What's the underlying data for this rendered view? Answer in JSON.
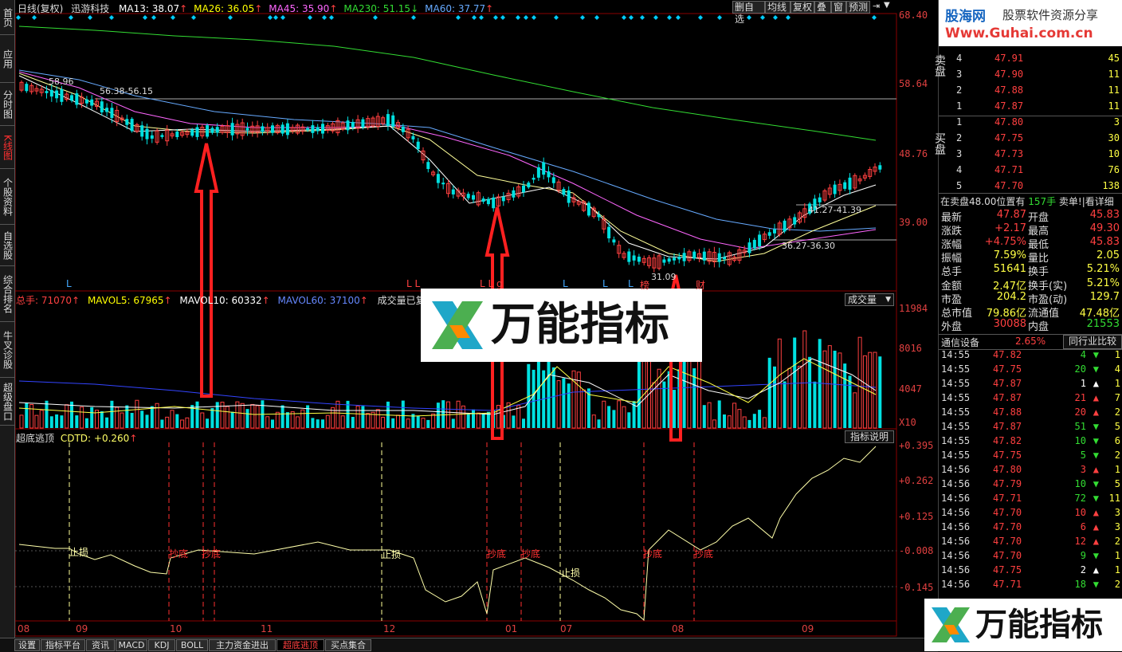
{
  "nav": [
    "首页",
    "应用",
    "分时图",
    "K线图",
    "个股资料",
    "自选股",
    "综合排名",
    "牛叉诊股",
    "超级盘口"
  ],
  "header": {
    "period": "日线(复权)",
    "stock": "迅游科技",
    "mas": [
      {
        "text": "MA13: 38.07",
        "arrow": "↑",
        "color": "#ffffff"
      },
      {
        "text": "MA26: 36.05",
        "arrow": "↑",
        "color": "#ffff00"
      },
      {
        "text": "MA45: 35.90",
        "arrow": "↑",
        "color": "#ff66ff"
      },
      {
        "text": "MA230: 51.15",
        "arrow": "↓",
        "color": "#33dd33"
      },
      {
        "text": "MA60: 37.77",
        "arrow": "↑",
        "color": "#66aaff"
      }
    ]
  },
  "toolbar": [
    "删自选",
    "均线",
    "复权",
    "叠",
    "窗",
    "预测"
  ],
  "price_axis": [
    "68.40",
    "58.64",
    "48.76",
    "39.00"
  ],
  "price_annotations": [
    "58.96",
    "56.38-56.15",
    "41.27-41.39",
    "36.27-36.30",
    "31.09"
  ],
  "markers": [
    "L",
    "L L",
    "L L g",
    "L",
    "L",
    "L",
    "榜",
    "财"
  ],
  "volume": {
    "title": "总手: 71070",
    "ma5": "MAVOL5: 67965",
    "ma10": "MAVOL10: 60332",
    "ma60": "MAVOL60: 37100",
    "note": "成交量已复权",
    "dropdown": "成交量",
    "axis": [
      "11984",
      "8016",
      "4047",
      "X10"
    ]
  },
  "indicator": {
    "title": "超底逃顶",
    "value": "CDTD: +0.260",
    "help": "指标说明",
    "axis": [
      "+0.395",
      "+0.262",
      "+0.125",
      "-0.008",
      "-0.145"
    ],
    "labels": [
      {
        "text": "止损",
        "kind": "stop"
      },
      {
        "text": "抄底",
        "kind": "buy"
      },
      {
        "text": "抄底",
        "kind": "buy"
      },
      {
        "text": "止损",
        "kind": "stop"
      },
      {
        "text": "抄底",
        "kind": "buy"
      },
      {
        "text": "抄底",
        "kind": "buy"
      },
      {
        "text": "止损",
        "kind": "stop"
      },
      {
        "text": "抄底",
        "kind": "buy"
      },
      {
        "text": "抄底",
        "kind": "buy"
      }
    ]
  },
  "x_axis": [
    "08",
    "09",
    "10",
    "11",
    "12",
    "01",
    "07",
    "08",
    "09"
  ],
  "watermark": {
    "brand": "股海网",
    "slogan": "股票软件资源分享",
    "url": "Www.Guhai.com.cn"
  },
  "overlay_logo": "万能指标",
  "bottom_tabs": [
    "设置",
    "指标平台",
    "资讯",
    "MACD",
    "KDJ",
    "BOLL",
    "主力资金进出",
    "超底逃顶",
    "买点集合"
  ],
  "orderbook": {
    "sell_label": "卖盘",
    "buy_label": "买盘",
    "sell": [
      {
        "lvl": "4",
        "price": "47.91",
        "vol": "45"
      },
      {
        "lvl": "3",
        "price": "47.90",
        "vol": "11"
      },
      {
        "lvl": "2",
        "price": "47.88",
        "vol": "11"
      },
      {
        "lvl": "1",
        "price": "47.87",
        "vol": "11"
      }
    ],
    "buy": [
      {
        "lvl": "1",
        "price": "47.80",
        "vol": "3"
      },
      {
        "lvl": "2",
        "price": "47.75",
        "vol": "30"
      },
      {
        "lvl": "3",
        "price": "47.73",
        "vol": "10"
      },
      {
        "lvl": "4",
        "price": "47.71",
        "vol": "76"
      },
      {
        "lvl": "5",
        "price": "47.70",
        "vol": "138"
      }
    ],
    "notice_left": "在卖盘48.00位置有",
    "notice_qty": "157手",
    "notice_right": "卖单!|看详细"
  },
  "stats": [
    {
      "l1": "最新",
      "v1": "47.87",
      "l2": "开盘",
      "v2": "45.83"
    },
    {
      "l1": "涨跌",
      "v1": "+2.17",
      "l2": "最高",
      "v2": "49.30"
    },
    {
      "l1": "涨幅",
      "v1": "+4.75%",
      "l2": "最低",
      "v2": "45.83"
    },
    {
      "l1": "振幅",
      "v1": "7.59%",
      "l2": "量比",
      "v2": "2.05"
    },
    {
      "l1": "总手",
      "v1": "51641",
      "l2": "换手",
      "v2": "5.21%"
    },
    {
      "l1": "金额",
      "v1": "2.47亿",
      "l2": "换手(实)",
      "v2": "5.21%"
    },
    {
      "l1": "市盈",
      "v1": "204.2",
      "l2": "市盈(动)",
      "v2": "129.7"
    },
    {
      "l1": "总市值",
      "v1": "79.86亿",
      "l2": "流通值",
      "v2": "47.48亿"
    },
    {
      "l1": "外盘",
      "v1": "30088",
      "l2": "内盘",
      "v2": "21553"
    }
  ],
  "sector": {
    "name": "通信设备",
    "pct": "2.65%",
    "btn": "同行业比较"
  },
  "ticks": [
    {
      "t": "14:55",
      "p": "47.82",
      "v": "4",
      "d": "down",
      "n": "1"
    },
    {
      "t": "14:55",
      "p": "47.75",
      "v": "20",
      "d": "down",
      "n": "4"
    },
    {
      "t": "14:55",
      "p": "47.87",
      "v": "1",
      "d": "up",
      "n": "1"
    },
    {
      "t": "14:55",
      "p": "47.87",
      "v": "21",
      "d": "up",
      "n": "7"
    },
    {
      "t": "14:55",
      "p": "47.88",
      "v": "20",
      "d": "up",
      "n": "2"
    },
    {
      "t": "14:55",
      "p": "47.87",
      "v": "51",
      "d": "down",
      "n": "5"
    },
    {
      "t": "14:55",
      "p": "47.82",
      "v": "10",
      "d": "down",
      "n": "6"
    },
    {
      "t": "14:55",
      "p": "47.75",
      "v": "5",
      "d": "down",
      "n": "2"
    },
    {
      "t": "14:56",
      "p": "47.80",
      "v": "3",
      "d": "up",
      "n": "1"
    },
    {
      "t": "14:56",
      "p": "47.79",
      "v": "10",
      "d": "down",
      "n": "5"
    },
    {
      "t": "14:56",
      "p": "47.71",
      "v": "72",
      "d": "down",
      "n": "11"
    },
    {
      "t": "14:56",
      "p": "47.70",
      "v": "10",
      "d": "up",
      "n": "3"
    },
    {
      "t": "14:56",
      "p": "47.70",
      "v": "6",
      "d": "up",
      "n": "3"
    },
    {
      "t": "14:56",
      "p": "47.70",
      "v": "12",
      "d": "up",
      "n": "2"
    },
    {
      "t": "14:56",
      "p": "47.70",
      "v": "9",
      "d": "down",
      "n": "1"
    },
    {
      "t": "14:56",
      "p": "47.75",
      "v": "2",
      "d": "up",
      "n": "1"
    },
    {
      "t": "14:56",
      "p": "47.71",
      "v": "18",
      "d": "down",
      "n": "2"
    }
  ],
  "colors": {
    "up": "#ff4040",
    "down": "#00d0d0",
    "ma13": "#ffffff",
    "ma26": "#ffff00",
    "ma45": "#ff66ff",
    "ma230": "#33dd33",
    "ma60": "#66aaff"
  }
}
